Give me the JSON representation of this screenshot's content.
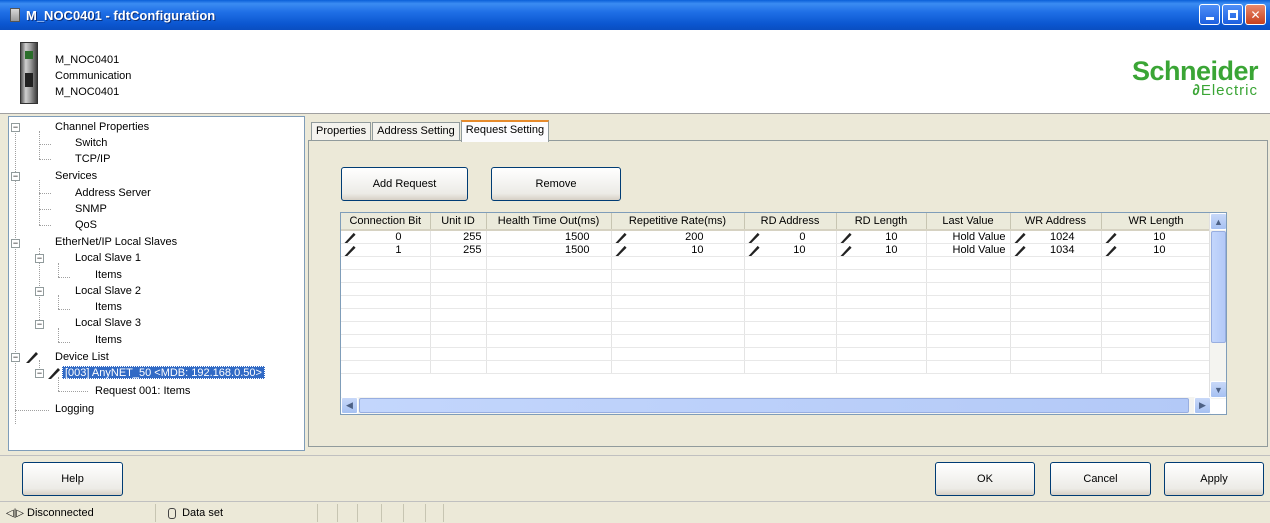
{
  "window": {
    "title": "M_NOC0401 - fdtConfiguration"
  },
  "header": {
    "line1": "M_NOC0401",
    "line2": "Communication",
    "line3": "M_NOC0401",
    "brand_top": "Schneider",
    "brand_bottom": "Electric",
    "brand_color": "#3aa535"
  },
  "tree": {
    "channel_properties": "Channel Properties",
    "switch": "Switch",
    "tcpip": "TCP/IP",
    "services": "Services",
    "address_server": "Address Server",
    "snmp": "SNMP",
    "qos": "QoS",
    "ethernetip": "EtherNet/IP Local Slaves",
    "local_slave_1": "Local Slave 1",
    "items_1": "Items",
    "local_slave_2": "Local Slave 2",
    "items_2": "Items",
    "local_slave_3": "Local Slave 3",
    "items_3": "Items",
    "device_list": "Device List",
    "device": "[003] AnyNET_50 <MDB: 192.168.0.50>",
    "request": "Request 001: Items",
    "logging": "Logging"
  },
  "tabs": [
    "Properties",
    "Address Setting",
    "Request Setting"
  ],
  "actions": {
    "add_request": "Add Request",
    "remove": "Remove"
  },
  "grid": {
    "columns": [
      "Connection Bit",
      "Unit ID",
      "Health Time Out(ms)",
      "Repetitive Rate(ms)",
      "RD Address",
      "RD Length",
      "Last Value",
      "WR Address",
      "WR Length"
    ],
    "rows": [
      [
        "0",
        "255",
        "1500",
        "200",
        "0",
        "10",
        "Hold Value",
        "1024",
        "10"
      ],
      [
        "1",
        "255",
        "1500",
        "10",
        "10",
        "10",
        "Hold Value",
        "1034",
        "10"
      ]
    ]
  },
  "footer": {
    "help": "Help",
    "ok": "OK",
    "cancel": "Cancel",
    "apply": "Apply"
  },
  "status": {
    "connection": "Disconnected",
    "data": "Data set"
  }
}
